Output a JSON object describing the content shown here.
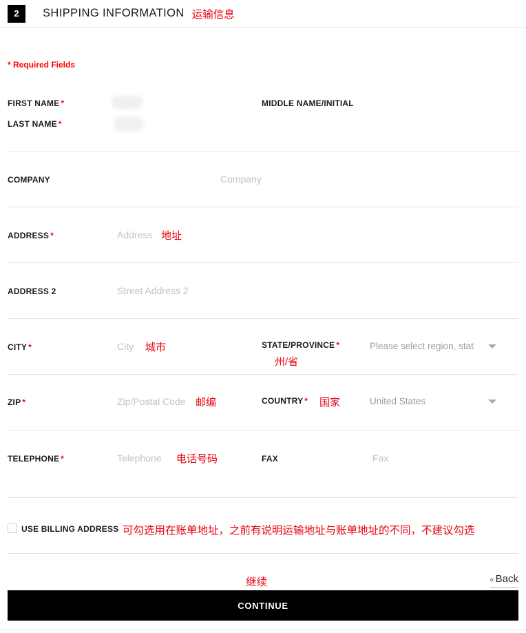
{
  "header": {
    "step_number": "2",
    "title": "SHIPPING INFORMATION",
    "annotation_cn": "运输信息"
  },
  "required_note": "* Required Fields",
  "required_marker": "*",
  "fields": {
    "first_name": {
      "label": "FIRST NAME",
      "required": true,
      "value_redacted": true
    },
    "last_name": {
      "label": "LAST NAME",
      "required": true,
      "value_redacted": true
    },
    "middle_name": {
      "label": "MIDDLE NAME/INITIAL",
      "required": false
    },
    "company": {
      "label": "COMPANY",
      "required": false,
      "placeholder": "Company"
    },
    "address": {
      "label": "ADDRESS",
      "required": true,
      "placeholder": "Address",
      "annotation_cn": "地址"
    },
    "address2": {
      "label": "ADDRESS 2",
      "required": false,
      "placeholder": "Street Address 2"
    },
    "city": {
      "label": "CITY",
      "required": true,
      "placeholder": "City",
      "annotation_cn": "城市"
    },
    "state": {
      "label": "STATE/PROVINCE",
      "required": true,
      "selected": "Please select region, stat",
      "annotation_cn": "州/省"
    },
    "zip": {
      "label": "ZIP",
      "required": true,
      "placeholder": "Zip/Postal Code",
      "annotation_cn": "邮编"
    },
    "country": {
      "label": "COUNTRY",
      "required": true,
      "selected": "United States",
      "annotation_cn": "国家"
    },
    "telephone": {
      "label": "TELEPHONE",
      "required": true,
      "placeholder": "Telephone",
      "annotation_cn": "电话号码"
    },
    "fax": {
      "label": "FAX",
      "required": false,
      "placeholder": "Fax"
    }
  },
  "billing": {
    "label": "USE BILLING ADDRESS",
    "checked": false,
    "annotation_cn": "可勾选用在账单地址，之前有说明运输地址与账单地址的不同，不建议勾选"
  },
  "footer": {
    "continue_label": "CONTINUE",
    "continue_annotation_cn": "继续",
    "back_label": "Back",
    "back_chevron": "«"
  },
  "colors": {
    "annotation_red": "#e8000d",
    "required_red": "#ff0000",
    "button_black": "#000000",
    "divider_gray": "#e2e2e2",
    "placeholder_gray": "#c2c2c2"
  }
}
